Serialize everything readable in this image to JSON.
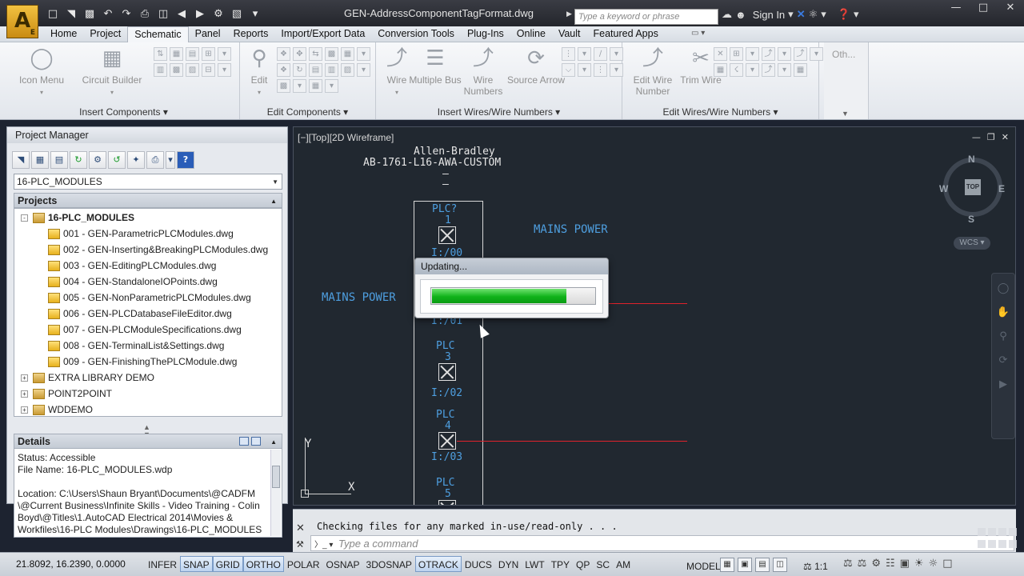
{
  "window": {
    "document_title": "GEN-AddressComponentTagFormat.dwg",
    "search_placeholder": "Type a keyword or phrase",
    "sign_in": "Sign In",
    "logo_letter": "A",
    "logo_sub": "E"
  },
  "ribbon": {
    "tabs": [
      "Home",
      "Project",
      "Schematic",
      "Panel",
      "Reports",
      "Import/Export Data",
      "Conversion Tools",
      "Plug-Ins",
      "Online",
      "Vault",
      "Featured Apps"
    ],
    "active_tab": "Schematic",
    "panels": {
      "insert_components": {
        "title": "Insert Components",
        "icon_menu": "Icon Menu",
        "circuit_builder": "Circuit Builder"
      },
      "edit_components": {
        "title": "Edit Components",
        "edit": "Edit"
      },
      "insert_wires": {
        "title": "Insert Wires/Wire Numbers",
        "wire": "Wire",
        "multiple_bus": "Multiple Bus",
        "wire_numbers": "Wire Numbers",
        "source_arrow": "Source Arrow"
      },
      "edit_wires": {
        "title": "Edit Wires/Wire Numbers",
        "edit_wire_number": "Edit Wire Number",
        "trim_wire": "Trim Wire"
      },
      "other": {
        "label": "Oth..."
      }
    }
  },
  "project_manager": {
    "title": "Project Manager",
    "selected_project": "16-PLC_MODULES",
    "projects_header": "Projects",
    "active_project": "16-PLC_MODULES",
    "files": [
      "001 - GEN-ParametricPLCModules.dwg",
      "002 - GEN-Inserting&BreakingPLCModules.dwg",
      "003 - GEN-EditingPLCModules.dwg",
      "004 - GEN-StandaloneIOPoints.dwg",
      "005 - GEN-NonParametricPLCModules.dwg",
      "006 - GEN-PLCDatabaseFileEditor.dwg",
      "007 - GEN-PLCModuleSpecifications.dwg",
      "008 - GEN-TerminalList&Settings.dwg",
      "009 - GEN-FinishingThePLCModule.dwg"
    ],
    "other_projects": [
      "EXTRA LIBRARY DEMO",
      "POINT2POINT",
      "WDDEMO"
    ],
    "details_header": "Details",
    "details": {
      "status": "Status: Accessible",
      "file_name": "File Name: 16-PLC_MODULES.wdp",
      "location": "Location: C:\\Users\\Shaun Bryant\\Documents\\@CADFM \\@Current Business\\Infinite Skills - Video Training - Colin Boyd\\@Titles\\1.AutoCAD Electrical 2014\\Movies & Workfiles\\16-PLC Modules\\Drawings\\16-PLC_MODULES"
    }
  },
  "drawing": {
    "viewport_label": "[−][Top][2D Wireframe]",
    "manufacturer": "Allen-Bradley",
    "catalog": "AB-1761-L16-AWA-CUSTOM",
    "dash": "—",
    "mains_left": "MAINS POWER",
    "mains_right": "MAINS POWER",
    "plc_tags": [
      {
        "tag": "PLC?",
        "num": "1",
        "addr": "I:/00"
      },
      {
        "tag": "PLC",
        "num": "3",
        "addr": "I:/02"
      },
      {
        "tag": "PLC",
        "num": "4",
        "addr": "I:/03"
      },
      {
        "tag": "PLC",
        "num": "5"
      }
    ],
    "addr_hidden": "I:/01",
    "compass": {
      "n": "N",
      "s": "S",
      "e": "E",
      "w": "W",
      "top": "TOP"
    },
    "wcs": "WCS",
    "ucs_x": "X",
    "ucs_y": "Y"
  },
  "dialog": {
    "title": "Updating...",
    "progress_percent": 82
  },
  "command_line": {
    "history": "Checking files for any marked in-use/read-only . . .",
    "placeholder": "Type a command"
  },
  "status_bar": {
    "coordinates": "21.8092, 16.2390, 0.0000",
    "toggles": [
      {
        "label": "INFER",
        "on": false
      },
      {
        "label": "SNAP",
        "on": true
      },
      {
        "label": "GRID",
        "on": true
      },
      {
        "label": "ORTHO",
        "on": true
      },
      {
        "label": "POLAR",
        "on": false
      },
      {
        "label": "OSNAP",
        "on": false
      },
      {
        "label": "3DOSNAP",
        "on": false
      },
      {
        "label": "OTRACK",
        "on": true
      },
      {
        "label": "DUCS",
        "on": false
      },
      {
        "label": "DYN",
        "on": false
      },
      {
        "label": "LWT",
        "on": false
      },
      {
        "label": "TPY",
        "on": false
      },
      {
        "label": "QP",
        "on": false
      },
      {
        "label": "SC",
        "on": false
      },
      {
        "label": "AM",
        "on": false
      }
    ],
    "model": "MODEL",
    "scale": "1:1"
  }
}
